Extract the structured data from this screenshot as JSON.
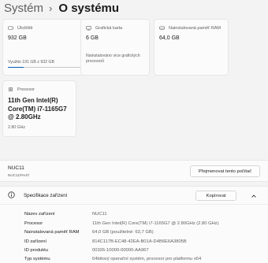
{
  "breadcrumb": {
    "parent": "Systém",
    "current": "O systému"
  },
  "cards": {
    "storage": {
      "label": "Úložiště",
      "value": "932 GB",
      "usage_text": "Využito 191 GB z 932 GB",
      "used_fraction": 0.205
    },
    "gpu": {
      "label": "Grafická karta",
      "value": "6 GB",
      "note": "Nainstalováno více grafických procesorů"
    },
    "ram": {
      "label": "Nainstalovaná paměť RAM",
      "value": "64,0 GB"
    },
    "cpu": {
      "label": "Procesor",
      "value": "11th Gen Intel(R) Core(TM) i7-1165G7 @ 2.80GHz",
      "freq": "2.80 GHz"
    }
  },
  "device": {
    "name": "NUC11",
    "model": "NUC11PAHi7",
    "rename_label": "Přejmenovat tento počítač"
  },
  "specs": {
    "title": "Specifikace zařízení",
    "copy_label": "Kopírovat",
    "rows": [
      {
        "key": "Název zařízení",
        "value": "NUC11"
      },
      {
        "key": "Procesor",
        "value": "11th Gen Intel(R) Core(TM) i7-1165G7 @ 2.80GHz (2.80 GHz)"
      },
      {
        "key": "Nainstalovaná paměť RAM",
        "value": "64,0 GB (použitelné: 63,7 GB)"
      },
      {
        "key": "ID zařízení",
        "value": "814C117B-EC48-42EA-B01A-D4B6E6A3805B"
      },
      {
        "key": "ID produktu",
        "value": "00326-10000-00000-AA967"
      },
      {
        "key": "Typ systému",
        "value": "64bitový operační systém, procesor pro platformu x64"
      }
    ]
  }
}
